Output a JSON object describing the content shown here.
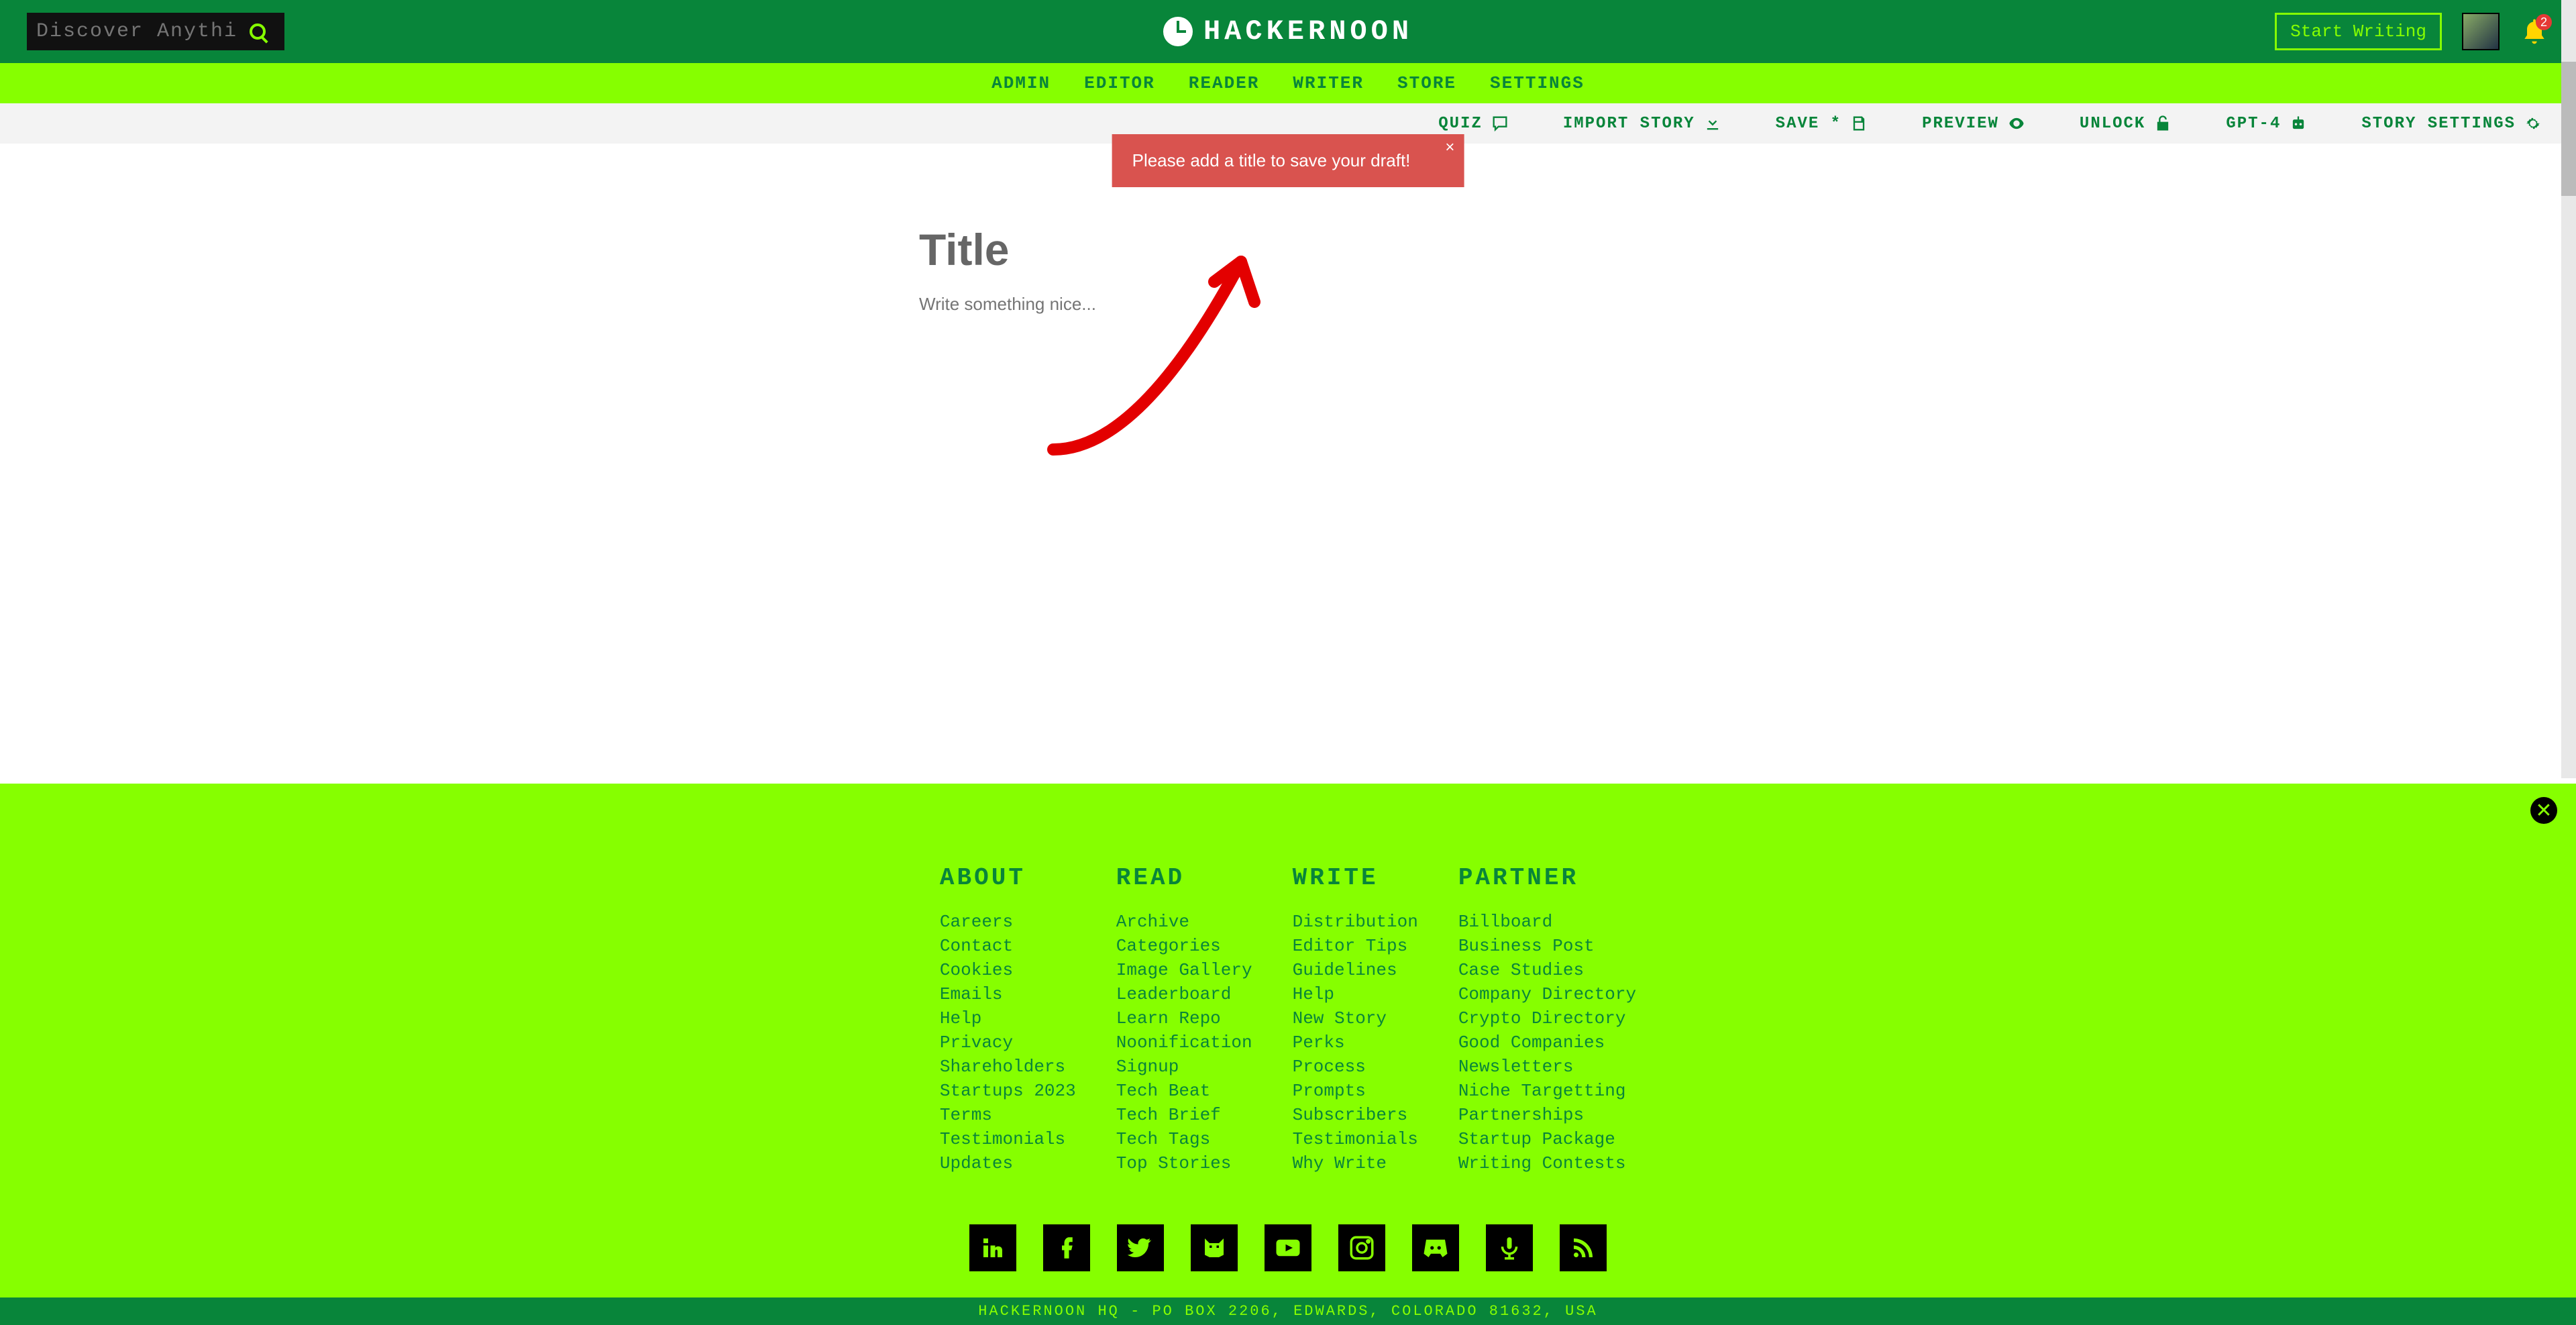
{
  "search": {
    "placeholder": "Discover Anything"
  },
  "brand": "HACKERNOON",
  "start_writing": "Start Writing",
  "notification_count": "2",
  "nav": [
    "ADMIN",
    "EDITOR",
    "READER",
    "WRITER",
    "STORE",
    "SETTINGS"
  ],
  "toolbar": {
    "quiz": "QUIZ",
    "import": "IMPORT STORY",
    "save": "SAVE *",
    "preview": "PREVIEW",
    "unlock": "UNLOCK",
    "gpt4": "GPT-4",
    "settings": "STORY SETTINGS"
  },
  "toast": {
    "msg": "Please add a title to save your draft!",
    "close": "×"
  },
  "editor": {
    "title_ph": "Title",
    "body_ph": "Write something nice..."
  },
  "footer": {
    "about": {
      "h": "ABOUT",
      "items": [
        "Careers",
        "Contact",
        "Cookies",
        "Emails",
        "Help",
        "Privacy",
        "Shareholders",
        "Startups 2023",
        "Terms",
        "Testimonials",
        "Updates"
      ]
    },
    "read": {
      "h": "READ",
      "items": [
        "Archive",
        "Categories",
        "Image Gallery",
        "Leaderboard",
        "Learn Repo",
        "Noonification",
        "Signup",
        "Tech Beat",
        "Tech Brief",
        "Tech Tags",
        "Top Stories"
      ]
    },
    "write": {
      "h": "WRITE",
      "items": [
        "Distribution",
        "Editor Tips",
        "Guidelines",
        "Help",
        "New Story",
        "Perks",
        "Process",
        "Prompts",
        "Subscribers",
        "Testimonials",
        "Why Write"
      ]
    },
    "partner": {
      "h": "PARTNER",
      "items": [
        "Billboard",
        "Business Post",
        "Case Studies",
        "Company Directory",
        "Crypto Directory",
        "Good Companies",
        "Newsletters",
        "Niche Targetting",
        "Partnerships",
        "Startup Package",
        "Writing Contests"
      ]
    },
    "socials": [
      "linkedin",
      "facebook",
      "twitter",
      "pixel-cat",
      "youtube",
      "instagram",
      "discord",
      "podcast",
      "rss"
    ],
    "close": "✕"
  },
  "address": "HACKERNOON HQ - PO BOX 2206, EDWARDS, COLORADO 81632, USA"
}
